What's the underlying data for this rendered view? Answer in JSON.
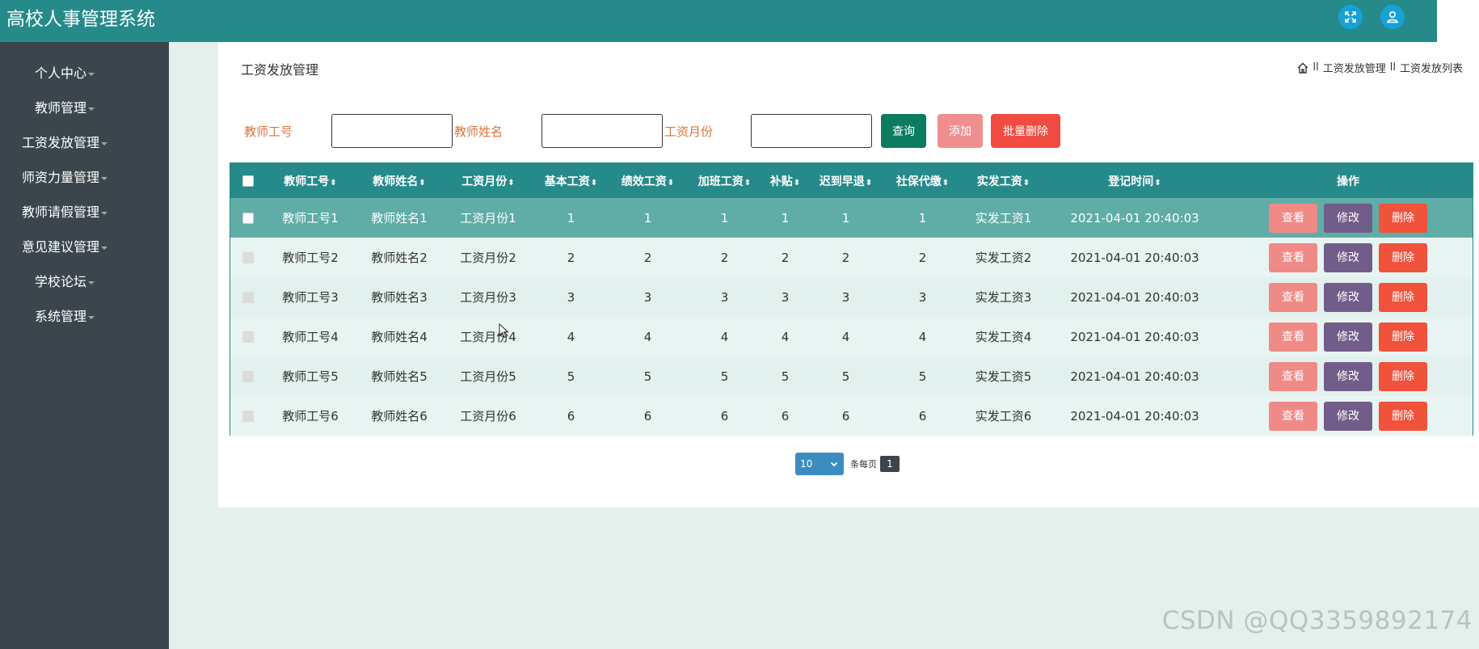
{
  "header": {
    "app_title": "高校人事管理系统",
    "icons": [
      "fullscreen-icon",
      "user-icon"
    ]
  },
  "sidebar": {
    "items": [
      {
        "label": "个人中心"
      },
      {
        "label": "教师管理"
      },
      {
        "label": "工资发放管理"
      },
      {
        "label": "师资力量管理"
      },
      {
        "label": "教师请假管理"
      },
      {
        "label": "意见建议管理"
      },
      {
        "label": "学校论坛"
      },
      {
        "label": "系统管理"
      }
    ]
  },
  "page": {
    "title": "工资发放管理",
    "breadcrumb": [
      "工资发放管理",
      "工资发放列表"
    ],
    "breadcrumb_sep": "ll"
  },
  "search": {
    "fields": [
      {
        "label": "教师工号",
        "value": ""
      },
      {
        "label": "教师姓名",
        "value": ""
      },
      {
        "label": "工资月份",
        "value": ""
      }
    ],
    "query_label": "查询",
    "add_label": "添加",
    "batch_delete_label": "批量删除"
  },
  "table": {
    "columns": [
      "教师工号",
      "教师姓名",
      "工资月份",
      "基本工资",
      "绩效工资",
      "加班工资",
      "补贴",
      "迟到早退",
      "社保代缴",
      "实发工资",
      "登记时间",
      "操作"
    ],
    "rows": [
      [
        "教师工号1",
        "教师姓名1",
        "工资月份1",
        "1",
        "1",
        "1",
        "1",
        "1",
        "1",
        "实发工资1",
        "2021-04-01 20:40:03"
      ],
      [
        "教师工号2",
        "教师姓名2",
        "工资月份2",
        "2",
        "2",
        "2",
        "2",
        "2",
        "2",
        "实发工资2",
        "2021-04-01 20:40:03"
      ],
      [
        "教师工号3",
        "教师姓名3",
        "工资月份3",
        "3",
        "3",
        "3",
        "3",
        "3",
        "3",
        "实发工资3",
        "2021-04-01 20:40:03"
      ],
      [
        "教师工号4",
        "教师姓名4",
        "工资月份4",
        "4",
        "4",
        "4",
        "4",
        "4",
        "4",
        "实发工资4",
        "2021-04-01 20:40:03"
      ],
      [
        "教师工号5",
        "教师姓名5",
        "工资月份5",
        "5",
        "5",
        "5",
        "5",
        "5",
        "5",
        "实发工资5",
        "2021-04-01 20:40:03"
      ],
      [
        "教师工号6",
        "教师姓名6",
        "工资月份6",
        "6",
        "6",
        "6",
        "6",
        "6",
        "6",
        "实发工资6",
        "2021-04-01 20:40:03"
      ]
    ],
    "actions": {
      "view": "查看",
      "edit": "修改",
      "delete": "删除"
    }
  },
  "pagination": {
    "page_size": "10",
    "per_page_label": "条每页",
    "current_page": "1"
  },
  "watermark": "CSDN @QQ3359892174",
  "colors": {
    "topbar": "#268a8a",
    "sidebar": "#3a464b",
    "query_button": "#0c7c5f",
    "add_button": "#f08e8e",
    "delete_button": "#f04c41",
    "edit_button": "#725d8a"
  }
}
